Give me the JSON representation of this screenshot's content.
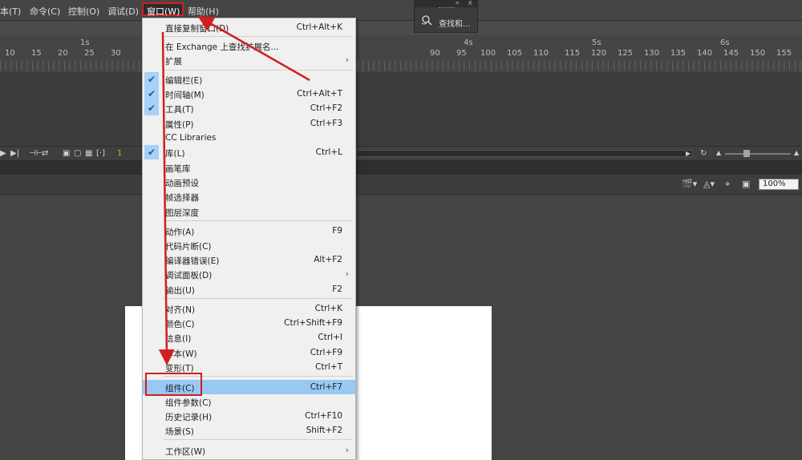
{
  "menubar": {
    "items": [
      {
        "label": "本(T)"
      },
      {
        "label": "命令(C)"
      },
      {
        "label": "控制(O)"
      },
      {
        "label": "调试(D)"
      },
      {
        "label": "窗口(W)"
      },
      {
        "label": "帮助(H)"
      }
    ]
  },
  "find_panel": {
    "label": "查找和..."
  },
  "ruler": {
    "seconds": [
      "1s",
      "4s",
      "5s",
      "6s"
    ],
    "frames": [
      "10",
      "15",
      "20",
      "25",
      "30",
      "90",
      "95",
      "100",
      "105",
      "110",
      "115",
      "120",
      "125",
      "130",
      "135",
      "140",
      "145",
      "150",
      "155"
    ]
  },
  "timeline": {
    "current_frame": "1"
  },
  "stage": {
    "zoom": "100%"
  },
  "window_menu": {
    "items": [
      {
        "label": "直接复制窗口(D)",
        "shortcut": "Ctrl+Alt+K"
      },
      {
        "label": "在 Exchange 上查找扩展名..."
      },
      {
        "label": "扩展",
        "submenu_glyph": "›"
      },
      {
        "label": "编辑栏(E)"
      },
      {
        "label": "时间轴(M)",
        "shortcut": "Ctrl+Alt+T"
      },
      {
        "label": "工具(T)",
        "shortcut": "Ctrl+F2"
      },
      {
        "label": "属性(P)",
        "shortcut": "Ctrl+F3"
      },
      {
        "label": "CC Libraries"
      },
      {
        "label": "库(L)",
        "shortcut": "Ctrl+L"
      },
      {
        "label": "画笔库"
      },
      {
        "label": "动画预设"
      },
      {
        "label": "帧选择器"
      },
      {
        "label": "图层深度"
      },
      {
        "label": "动作(A)",
        "shortcut": "F9"
      },
      {
        "label": "代码片断(C)"
      },
      {
        "label": "编译器错误(E)",
        "shortcut": "Alt+F2"
      },
      {
        "label": "调试面板(D)",
        "submenu_glyph": "›"
      },
      {
        "label": "输出(U)",
        "shortcut": "F2"
      },
      {
        "label": "对齐(N)",
        "shortcut": "Ctrl+K"
      },
      {
        "label": "颜色(C)",
        "shortcut": "Ctrl+Shift+F9"
      },
      {
        "label": "信息(I)",
        "shortcut": "Ctrl+I"
      },
      {
        "label": "样本(W)",
        "shortcut": "Ctrl+F9"
      },
      {
        "label": "变形(T)",
        "shortcut": "Ctrl+T"
      },
      {
        "label": "组件(C)",
        "shortcut": "Ctrl+F7"
      },
      {
        "label": "组件参数(C)"
      },
      {
        "label": "历史记录(H)",
        "shortcut": "Ctrl+F10"
      },
      {
        "label": "场景(S)",
        "shortcut": "Shift+F2"
      },
      {
        "label": "工作区(W)",
        "submenu_glyph": "›"
      }
    ],
    "checked": [
      "编辑栏(E)",
      "时间轴(M)",
      "工具(T)",
      "库(L)"
    ],
    "highlighted": "组件(C)"
  },
  "colors": {
    "annotation": "#d01f1f",
    "highlight": "#99c9f3",
    "check_bg": "#a9d0f5"
  }
}
